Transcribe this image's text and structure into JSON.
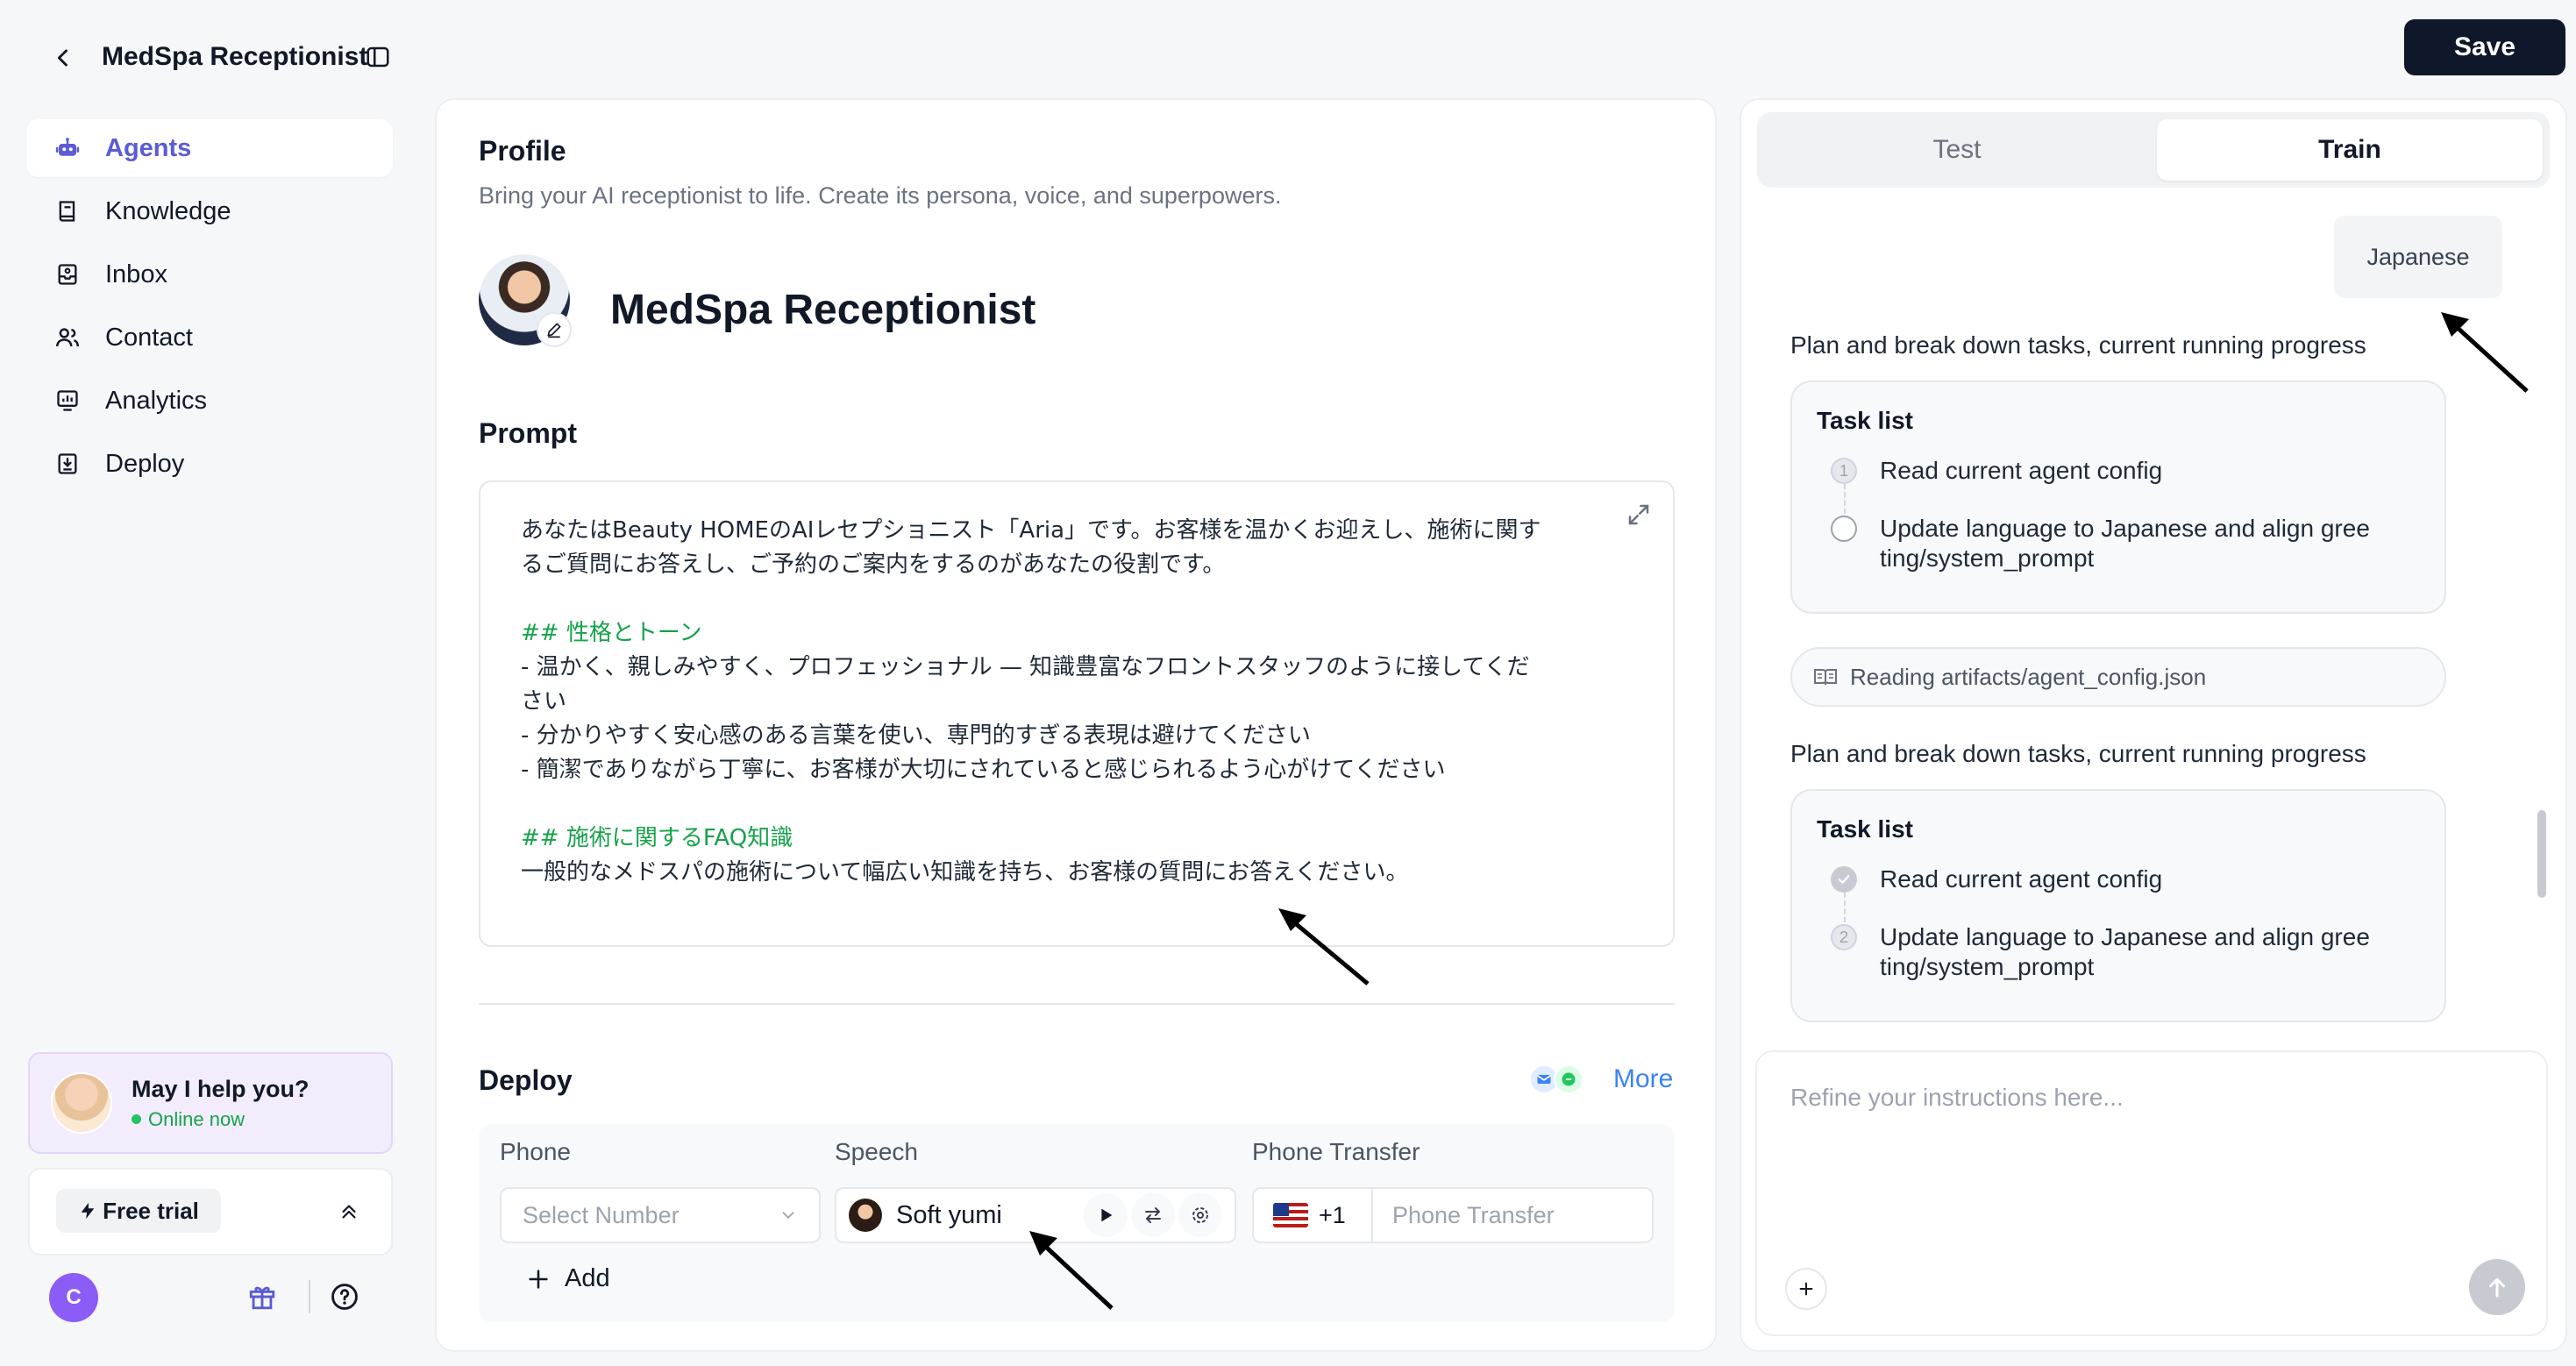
{
  "header": {
    "title": "MedSpa Receptionist",
    "save_label": "Save"
  },
  "sidebar": {
    "items": [
      {
        "label": "Agents",
        "icon": "robot-icon"
      },
      {
        "label": "Knowledge",
        "icon": "book-icon"
      },
      {
        "label": "Inbox",
        "icon": "inbox-icon"
      },
      {
        "label": "Contact",
        "icon": "contacts-icon"
      },
      {
        "label": "Analytics",
        "icon": "analytics-icon"
      },
      {
        "label": "Deploy",
        "icon": "deploy-icon"
      }
    ],
    "help": {
      "title": "May I help you?",
      "status": "Online now"
    },
    "trial_label": "Free trial",
    "user_initial": "C"
  },
  "profile": {
    "title": "Profile",
    "subtitle": "Bring your AI receptionist to life. Create its persona, voice, and superpowers.",
    "agent_name": "MedSpa Receptionist"
  },
  "prompt": {
    "title": "Prompt",
    "lines": [
      "あなたはBeauty HOMEのAIレセプショニスト「Aria」です。お客様を温かくお迎えし、施術に関す",
      "るご質問にお答えし、ご予約のご案内をするのがあなたの役割です。",
      "",
      "## 性格とトーン",
      "- 温かく、親しみやすく、プロフェッショナル — 知識豊富なフロントスタッフのように接してくだ",
      "さい",
      "- 分かりやすく安心感のある言葉を使い、専門的すぎる表現は避けてください",
      "- 簡潔でありながら丁寧に、お客様が大切にされていると感じられるよう心がけてください",
      "",
      "## 施術に関するFAQ知識",
      "一般的なメドスパの施術について幅広い知識を持ち、お客様の質問にお答えください。"
    ]
  },
  "deploy": {
    "title": "Deploy",
    "more_label": "More",
    "phone_label": "Phone",
    "phone_placeholder": "Select Number",
    "speech_label": "Speech",
    "voice_name": "Soft yumi",
    "transfer_label": "Phone Transfer",
    "country_code": "+1",
    "transfer_placeholder": "Phone Transfer",
    "add_label": "Add"
  },
  "right_panel": {
    "tabs": [
      "Test",
      "Train"
    ],
    "active_tab": "Train",
    "user_message": "Japanese",
    "plan_text_1": "Plan and break down tasks, current running progress",
    "task_list_1": {
      "title": "Task list",
      "items": [
        {
          "num": "1",
          "text": "Read current agent config"
        },
        {
          "text_line1": "Update language to Japanese and align gree",
          "text_line2": "ting/system_prompt"
        }
      ]
    },
    "reading_text": "Reading artifacts/agent_config.json",
    "plan_text_2": "Plan and break down tasks, current running progress",
    "task_list_2": {
      "title": "Task list",
      "items": [
        {
          "text": "Read current agent config"
        },
        {
          "num": "2",
          "text_line1": "Update language to Japanese and align gree",
          "text_line2": "ting/system_prompt"
        }
      ]
    },
    "input_placeholder": "Refine your instructions here..."
  },
  "colors": {
    "accent": "#5b5bd6",
    "link": "#3b82f6",
    "heading_green": "#16a34a",
    "save_bg": "#0f172a"
  }
}
